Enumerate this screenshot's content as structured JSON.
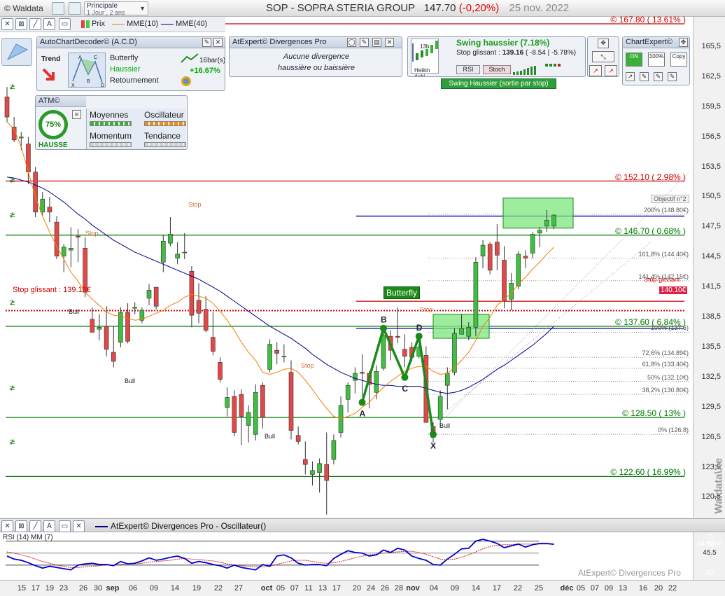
{
  "header": {
    "brand": "© Waldata",
    "layout_name": "Principale",
    "layout_sub": "1 Jour , 2 ans",
    "ticker": "SOP - SOPRA STERIA GROUP",
    "price": "147.70",
    "change": "(-0,20%)",
    "date": "25 nov. 2022"
  },
  "toolbar": {
    "legend": [
      {
        "label": "Prix",
        "color": "#333333"
      },
      {
        "label": "MME(10)",
        "color": "#f08000"
      },
      {
        "label": "MME(40)",
        "color": "#00008b"
      }
    ]
  },
  "acd": {
    "title": "AutoChartDecoder© (A.C.D)",
    "trend_label": "Trend",
    "pattern_name": "Butterfly",
    "direction": "Haussier",
    "pattern_type": "Retournement",
    "bars": "16bar(s)",
    "pct": "+16.67%",
    "points": [
      "A",
      "B",
      "C",
      "D",
      "X"
    ]
  },
  "atm": {
    "title": "ATM©",
    "gauge": "75%",
    "trend": "HAUSSE",
    "labels": {
      "moyennes": "Moyennes",
      "oscillateur": "Oscillateur",
      "momentum": "Momentum",
      "tendance": "Tendance"
    }
  },
  "divergences": {
    "title": "AtExpert© Divergences Pro",
    "line1": "Aucune divergence",
    "line2": "haussière ou baissière"
  },
  "swing": {
    "thumb_label": "Heikin Ashi",
    "thumb_top": "13b",
    "title": "Swing haussier (7.18%)",
    "stop_label": "Stop glissant : ",
    "stop_value": "139.16",
    "stop_change": " ( -8.54 | -5.78%)",
    "rsi": "RSI",
    "stoch": "Stoch",
    "signal": "Swing Haussier (sortie par stop)"
  },
  "chartexpert": {
    "title": "ChartExpert©",
    "buttons": [
      "ON",
      "100%",
      "Copy"
    ]
  },
  "overlay": {
    "stop_glissant": "Stop glissant : 139.16€",
    "butterfly": "Butterfly",
    "objectif": "Objectif n°2",
    "levels": [
      {
        "text": "© 167.80 ( 13.61% )",
        "price": 167.8,
        "color": "#cc0000"
      },
      {
        "text": "© 152.10 ( 2.98% )",
        "price": 152.1,
        "color": "#cc0000"
      },
      {
        "text": "© 146.70 ( 0.68% )",
        "price": 146.7,
        "color": "#007700"
      },
      {
        "text": "© 137.60 ( 6.84% )",
        "price": 137.6,
        "color": "#007700"
      },
      {
        "text": "© 128.50 ( 13% )",
        "price": 128.5,
        "color": "#007700"
      },
      {
        "text": "© 122.60 ( 16.99% )",
        "price": 122.6,
        "color": "#007700"
      }
    ],
    "fibs": [
      {
        "text": "200% (148.80€)",
        "price": 148.8
      },
      {
        "text": "161,8% (144.40€)",
        "price": 144.4
      },
      {
        "text": "141,4% (142.15€)",
        "price": 142.15
      },
      {
        "text": "100% (137.6)",
        "price": 137.0
      },
      {
        "text": "72,6% (134.89€)",
        "price": 134.5
      },
      {
        "text": "61,8% (133.40€)",
        "price": 133.4
      },
      {
        "text": "50% (132.10€)",
        "price": 132.1
      },
      {
        "text": "38,2% (130.80€)",
        "price": 130.8
      },
      {
        "text": "0% (126.8)",
        "price": 126.8
      }
    ],
    "stop_small": "Stop glissant",
    "stop_small_value": "140.10€",
    "stop_word": "Stop",
    "bull_word": "Bull"
  },
  "price_axis": {
    "ticks": [
      165.5,
      162.5,
      159.5,
      156.5,
      153.5,
      150.5,
      147.5,
      144.5,
      141.5,
      138.5,
      135.5,
      132.5,
      129.5,
      126.5,
      123.5,
      120.5
    ],
    "tick_labels": [
      "165,5",
      "162,5",
      "159,5",
      "156,5",
      "153,5",
      "150,5",
      "147,5",
      "144,5",
      "141,5",
      "138,5",
      "135,5",
      "132,5",
      "129,5",
      "126,5",
      "123,5",
      "120,5"
    ],
    "watermark": "Waldata\\Xe"
  },
  "oscillator": {
    "title": "AtExpert© Divergences Pro - Oscillateur()",
    "label": "RSI (14) MM (7)",
    "credit": "AtExpert© Divergences Pro",
    "tags": [
      {
        "text": "70",
        "color": "#c00000"
      },
      {
        "text": "64.5986",
        "color": "#00008b"
      },
      {
        "text": "50",
        "color": "#777777"
      },
      {
        "text": "45.5",
        "color": "#f1f1f1"
      },
      {
        "text": "30",
        "color": "#777777"
      }
    ]
  },
  "date_axis": {
    "labels": [
      {
        "t": "15",
        "m": false
      },
      {
        "t": "17",
        "m": false
      },
      {
        "t": "19",
        "m": false
      },
      {
        "t": "23",
        "m": false
      },
      {
        "t": "26",
        "m": false
      },
      {
        "t": "30",
        "m": false
      },
      {
        "t": "sep",
        "m": true
      },
      {
        "t": "06",
        "m": false
      },
      {
        "t": "09",
        "m": false
      },
      {
        "t": "14",
        "m": false
      },
      {
        "t": "19",
        "m": false
      },
      {
        "t": "22",
        "m": false
      },
      {
        "t": "27",
        "m": false
      },
      {
        "t": "oct",
        "m": true
      },
      {
        "t": "05",
        "m": false
      },
      {
        "t": "07",
        "m": false
      },
      {
        "t": "11",
        "m": false
      },
      {
        "t": "13",
        "m": false
      },
      {
        "t": "17",
        "m": false
      },
      {
        "t": "20",
        "m": false
      },
      {
        "t": "24",
        "m": false
      },
      {
        "t": "26",
        "m": false
      },
      {
        "t": "28",
        "m": false
      },
      {
        "t": "nov",
        "m": true
      },
      {
        "t": "04",
        "m": false
      },
      {
        "t": "09",
        "m": false
      },
      {
        "t": "14",
        "m": false
      },
      {
        "t": "17",
        "m": false
      },
      {
        "t": "22",
        "m": false
      },
      {
        "t": "25",
        "m": false
      },
      {
        "t": "déc",
        "m": true
      },
      {
        "t": "05",
        "m": false
      },
      {
        "t": "07",
        "m": false
      },
      {
        "t": "09",
        "m": false
      },
      {
        "t": "13",
        "m": false
      },
      {
        "t": "16",
        "m": false
      },
      {
        "t": "20",
        "m": false
      },
      {
        "t": "22",
        "m": false
      }
    ]
  },
  "chart_data": {
    "type": "candlestick",
    "ylim": [
      118.5,
      168.5
    ],
    "candles": [
      [
        160.5,
        161.5,
        158.0,
        158.5
      ],
      [
        157.5,
        158.5,
        156.0,
        156.2
      ],
      [
        156.4,
        157.0,
        155.2,
        156.5
      ],
      [
        155.8,
        156.5,
        151.8,
        153.0
      ],
      [
        153.0,
        153.5,
        148.5,
        149.0
      ],
      [
        149.0,
        151.0,
        148.6,
        150.3
      ],
      [
        149.5,
        150.5,
        148.0,
        149.0
      ],
      [
        148.0,
        148.6,
        144.3,
        144.6
      ],
      [
        144.6,
        145.8,
        143.0,
        145.5
      ],
      [
        145.2,
        147.5,
        143.5,
        145.4
      ],
      [
        146.6,
        147.3,
        144.0,
        146.5
      ],
      [
        145.4,
        146.5,
        140.5,
        141.0
      ],
      [
        138.3,
        139.5,
        137.0,
        137.0
      ],
      [
        137.3,
        138.8,
        136.2,
        137.5
      ],
      [
        137.6,
        139.6,
        134.6,
        135.3
      ],
      [
        135.0,
        137.6,
        133.5,
        134.1
      ],
      [
        136.0,
        139.5,
        135.5,
        139.0
      ],
      [
        139.0,
        139.9,
        135.9,
        136.1
      ],
      [
        139.4,
        140.0,
        138.8,
        139.5
      ],
      [
        138.2,
        139.5,
        137.9,
        139.2
      ],
      [
        140.4,
        141.8,
        139.7,
        141.2
      ],
      [
        141.5,
        141.5,
        139.3,
        139.6
      ],
      [
        144.0,
        146.7,
        143.0,
        146.1
      ],
      [
        145.9,
        148.5,
        145.6,
        146.8
      ],
      [
        144.4,
        146.0,
        143.8,
        144.8
      ],
      [
        145.0,
        146.9,
        144.3,
        145.0
      ],
      [
        143.1,
        143.6,
        137.5,
        138.7
      ],
      [
        140.2,
        141.9,
        137.9,
        138.9
      ],
      [
        139.3,
        140.6,
        137.0,
        137.2
      ],
      [
        136.5,
        139.0,
        134.7,
        135.1
      ],
      [
        134.0,
        134.5,
        132.0,
        132.3
      ],
      [
        129.5,
        131.5,
        128.6,
        130.5
      ],
      [
        130.6,
        131.2,
        126.6,
        127.0
      ],
      [
        130.8,
        131.3,
        125.7,
        128.6
      ],
      [
        127.7,
        129.7,
        126.0,
        129.0
      ],
      [
        126.8,
        131.8,
        126.2,
        131.0
      ],
      [
        131.7,
        132.0,
        127.4,
        128.5
      ],
      [
        133.3,
        136.3,
        133.0,
        135.8
      ],
      [
        135.2,
        136.0,
        133.8,
        134.9
      ],
      [
        134.6,
        135.8,
        134.0,
        134.6
      ],
      [
        133.0,
        134.2,
        126.3,
        127.2
      ],
      [
        126.7,
        127.6,
        125.8,
        126.1
      ],
      [
        124.3,
        126.1,
        122.8,
        123.8
      ],
      [
        122.8,
        124.1,
        121.7,
        123.2
      ],
      [
        123.0,
        124.4,
        121.0,
        123.9
      ],
      [
        123.8,
        127.0,
        118.8,
        122.2
      ],
      [
        124.3,
        126.8,
        123.8,
        126.2
      ],
      [
        127.0,
        130.6,
        126.5,
        129.7
      ],
      [
        130.3,
        132.0,
        129.0,
        131.7
      ],
      [
        132.2,
        133.5,
        130.9,
        132.9
      ],
      [
        133.0,
        134.8,
        130.6,
        132.9
      ],
      [
        132.9,
        133.1,
        129.4,
        131.8
      ],
      [
        131.0,
        133.7,
        130.3,
        133.1
      ],
      [
        133.4,
        137.2,
        133.2,
        136.7
      ],
      [
        136.6,
        137.2,
        134.2,
        135.2
      ],
      [
        136.6,
        139.5,
        135.9,
        136.5
      ],
      [
        135.3,
        136.8,
        133.5,
        134.6
      ],
      [
        135.5,
        136.0,
        134.1,
        134.5
      ],
      [
        134.6,
        135.8,
        134.4,
        135.5
      ],
      [
        134.7,
        135.6,
        129.5,
        128.0
      ],
      [
        127.6,
        128.0,
        126.0,
        126.5
      ],
      [
        128.3,
        131.2,
        127.6,
        130.6
      ],
      [
        131.7,
        133.5,
        129.3,
        132.9
      ],
      [
        133.0,
        137.4,
        132.7,
        136.9
      ],
      [
        136.8,
        138.8,
        136.8,
        137.4
      ],
      [
        136.6,
        138.0,
        136.2,
        137.5
      ],
      [
        137.5,
        144.5,
        136.6,
        144.0
      ],
      [
        144.6,
        146.2,
        143.4,
        145.7
      ],
      [
        145.8,
        146.0,
        142.8,
        143.2
      ],
      [
        146.0,
        147.8,
        143.2,
        144.7
      ],
      [
        144.2,
        145.6,
        139.4,
        140.1
      ],
      [
        140.3,
        142.9,
        139.2,
        141.9
      ],
      [
        141.6,
        145.1,
        141.3,
        144.8
      ],
      [
        144.6,
        145.2,
        143.4,
        144.4
      ],
      [
        144.9,
        147.0,
        144.4,
        146.8
      ],
      [
        146.9,
        147.5,
        145.5,
        147.2
      ],
      [
        147.6,
        149.2,
        147.0,
        148.2
      ],
      [
        147.6,
        148.8,
        147.3,
        148.7
      ]
    ],
    "mme10": [
      158.0,
      157.3,
      155.5,
      153.0,
      150.5,
      148.6,
      147.0,
      145.6,
      144.3,
      143.0,
      142.1,
      141.0,
      140.3,
      139.7,
      139.0,
      138.7,
      138.6,
      138.4,
      138.2,
      138.3,
      138.6,
      138.9,
      139.2,
      139.7,
      140.0,
      140.5,
      140.8,
      140.6,
      140.4,
      139.9,
      139.1,
      138.2,
      137.2,
      136.0,
      135.0,
      134.2,
      133.0,
      132.8,
      133.0,
      133.3,
      133.4,
      133.0,
      132.2,
      131.3,
      130.3,
      129.4,
      128.6,
      128.4,
      128.6,
      128.9,
      129.5,
      130.0,
      130.8,
      131.5,
      132.1,
      132.6,
      133.1,
      133.4,
      133.6,
      133.6,
      133.1,
      132.8,
      132.9,
      133.5,
      134.2,
      135.0,
      136.2,
      137.6,
      138.5,
      139.7,
      140.3,
      140.9,
      141.8,
      142.5,
      143.3,
      144.0,
      144.8,
      145.5
    ],
    "mme40": [
      152.5,
      152.4,
      152.2,
      152.0,
      151.7,
      151.4,
      151.0,
      150.5,
      150.0,
      149.4,
      148.8,
      148.3,
      147.7,
      147.2,
      146.7,
      146.2,
      145.8,
      145.4,
      145.0,
      144.7,
      144.4,
      144.1,
      143.8,
      143.5,
      143.2,
      142.9,
      142.6,
      142.3,
      141.9,
      141.5,
      141.1,
      140.6,
      140.1,
      139.6,
      139.1,
      138.6,
      138.1,
      137.6,
      137.2,
      136.8,
      136.4,
      135.9,
      135.4,
      134.8,
      134.3,
      133.8,
      133.4,
      133.0,
      132.7,
      132.4,
      132.2,
      132.0,
      131.8,
      131.7,
      131.7,
      131.6,
      131.6,
      131.6,
      131.6,
      131.4,
      131.2,
      131.0,
      130.9,
      131.0,
      131.2,
      131.5,
      131.9,
      132.3,
      132.8,
      133.3,
      133.7,
      134.2,
      134.7,
      135.2,
      135.7,
      136.3,
      136.9,
      137.6
    ],
    "butterfly_points": [
      {
        "label": "A",
        "x": 50,
        "y": 130.0
      },
      {
        "label": "B",
        "x": 53,
        "y": 137.4
      },
      {
        "label": "C",
        "x": 56,
        "y": 132.5
      },
      {
        "label": "D",
        "x": 58,
        "y": 136.6
      },
      {
        "label": "X",
        "x": 60,
        "y": 126.8
      }
    ],
    "rsi": [
      45,
      40,
      38,
      34,
      29,
      25,
      28,
      26,
      24,
      22,
      30,
      32,
      33,
      31,
      31,
      29,
      36,
      32,
      33,
      37,
      42,
      38,
      40,
      43,
      45,
      41,
      33,
      36,
      34,
      31,
      29,
      25,
      30,
      26,
      24,
      22,
      31,
      28,
      45,
      47,
      42,
      33,
      30,
      31,
      31,
      29,
      41,
      48,
      54,
      51,
      50,
      45,
      47,
      55,
      51,
      58,
      55,
      45,
      41,
      38,
      31,
      30,
      40,
      48,
      57,
      58,
      70,
      73,
      70,
      66,
      59,
      62,
      65,
      60,
      64,
      66,
      66,
      64.6
    ],
    "rsi_mm": [
      52,
      50,
      47,
      44,
      40,
      36,
      33,
      30,
      28,
      26,
      26,
      27,
      28,
      29,
      30,
      30,
      31,
      32,
      32,
      33,
      35,
      36,
      37,
      38,
      40,
      41,
      40,
      39,
      38,
      37,
      35,
      32,
      30,
      29,
      28,
      27,
      27,
      28,
      31,
      34,
      37,
      38,
      38,
      36,
      34,
      33,
      34,
      36,
      39,
      42,
      45,
      47,
      48,
      50,
      51,
      52,
      53,
      53,
      51,
      48,
      44,
      40,
      39,
      40,
      43,
      47,
      52,
      57,
      61,
      63,
      64,
      64,
      65,
      65,
      65,
      65,
      65,
      65
    ]
  }
}
